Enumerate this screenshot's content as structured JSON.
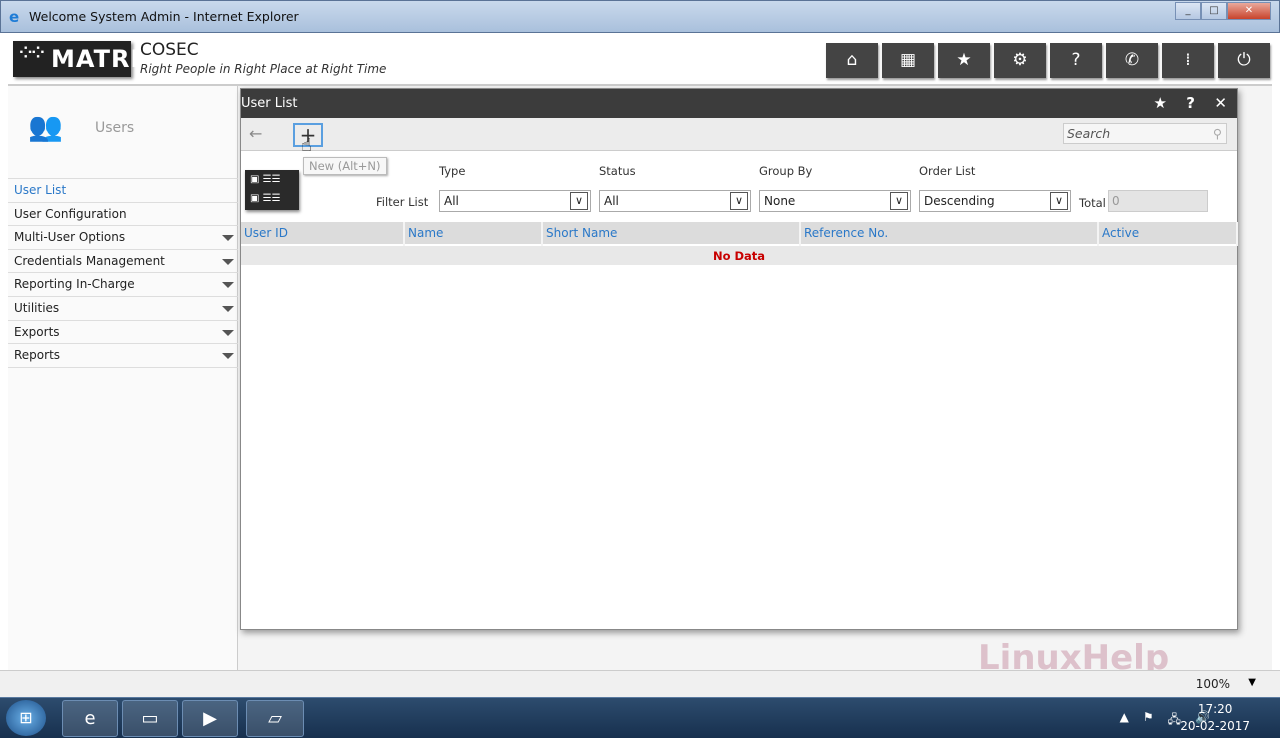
{
  "window": {
    "title": "Welcome System Admin - Internet Explorer"
  },
  "header": {
    "logo": "MATRIX",
    "product": "COSEC",
    "tagline": "Right People in Right Place at Right Time",
    "nav": [
      {
        "icon": "home-icon",
        "glyph": "⌂"
      },
      {
        "icon": "grid-icon",
        "glyph": "▦"
      },
      {
        "icon": "star-icon",
        "glyph": "★"
      },
      {
        "icon": "gear-icon",
        "glyph": "⚙"
      },
      {
        "icon": "help-icon",
        "glyph": "?"
      },
      {
        "icon": "phone-icon",
        "glyph": "✆"
      },
      {
        "icon": "dots-icon",
        "glyph": "⁞"
      },
      {
        "icon": "power-icon",
        "glyph": "⏻"
      }
    ]
  },
  "sidebar": {
    "title": "Users",
    "items": [
      {
        "label": "User List",
        "active": true
      },
      {
        "label": "User Configuration"
      },
      {
        "label": "Multi-User Options",
        "expandable": true
      },
      {
        "label": "Credentials Management",
        "expandable": true
      },
      {
        "label": "Reporting In-Charge",
        "expandable": true
      },
      {
        "label": "Utilities",
        "expandable": true
      },
      {
        "label": "Exports",
        "expandable": true
      },
      {
        "label": "Reports",
        "expandable": true
      }
    ]
  },
  "dialog": {
    "title": "User List",
    "tooltip": "New (Alt+N)",
    "search_placeholder": "Search",
    "filter_label": "Filter List",
    "filters": [
      {
        "label": "Type",
        "value": "All"
      },
      {
        "label": "Status",
        "value": "All"
      },
      {
        "label": "Group By",
        "value": "None"
      },
      {
        "label": "Order List",
        "value": "Descending"
      }
    ],
    "total_label": "Total",
    "total_value": "0",
    "columns": [
      "User ID",
      "Name",
      "Short Name",
      "Reference No.",
      "Active"
    ],
    "empty_text": "No Data"
  },
  "statusbar": {
    "zoom": "100%"
  },
  "watermark": "LinuxHelp",
  "taskbar": {
    "time": "17:20",
    "date": "20-02-2017"
  },
  "colors": {
    "accent": "#2a78c8",
    "no_data": "#c80000",
    "dark": "#3c3c3c"
  }
}
